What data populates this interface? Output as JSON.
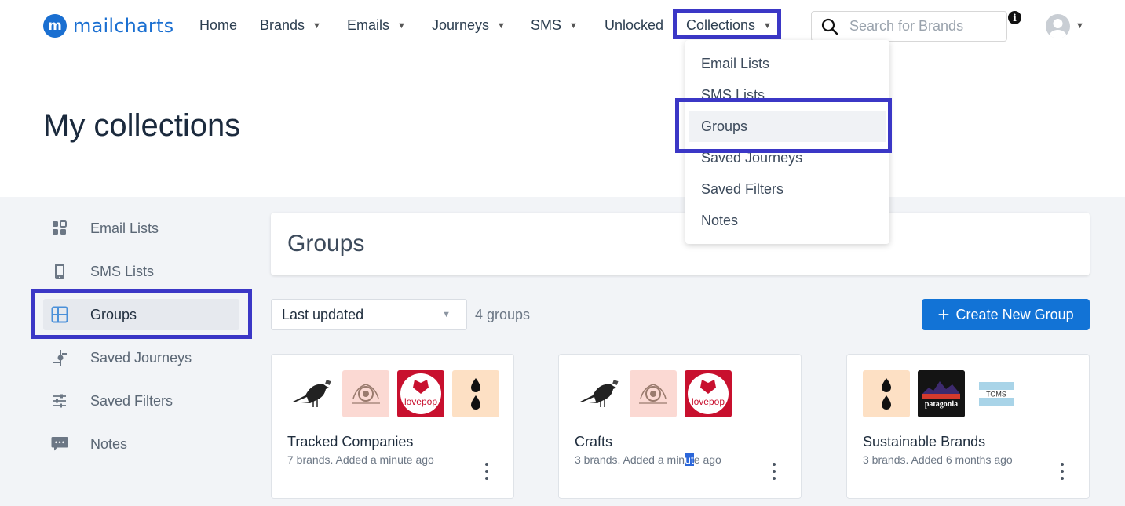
{
  "brand": {
    "name": "mailcharts",
    "mark": "m"
  },
  "nav": {
    "home": "Home",
    "brands": "Brands",
    "emails": "Emails",
    "journeys": "Journeys",
    "sms": "SMS",
    "unlocked": "Unlocked",
    "collections": "Collections"
  },
  "search": {
    "placeholder": "Search for Brands",
    "value": ""
  },
  "info_icon": "i",
  "dropdown": {
    "items": [
      "Email Lists",
      "SMS Lists",
      "Groups",
      "Saved Journeys",
      "Saved Filters",
      "Notes"
    ],
    "active": "Groups"
  },
  "page_title": "My collections",
  "sidebar": {
    "items": [
      {
        "label": "Email Lists",
        "icon": "grid-icon"
      },
      {
        "label": "SMS Lists",
        "icon": "phone-icon"
      },
      {
        "label": "Groups",
        "icon": "layout-icon"
      },
      {
        "label": "Saved Journeys",
        "icon": "journey-icon"
      },
      {
        "label": "Saved Filters",
        "icon": "sliders-icon"
      },
      {
        "label": "Notes",
        "icon": "chat-icon"
      }
    ],
    "active": "Groups"
  },
  "main": {
    "heading": "Groups",
    "sort": {
      "selected": "Last updated"
    },
    "count": "4 groups",
    "create_button": "Create New Group",
    "create_icon": "+"
  },
  "cards": [
    {
      "title": "Tracked Companies",
      "meta": "7 brands. Added a minute ago",
      "thumbs": [
        "pigeon-logo",
        "ornament-logo",
        "lovepop-logo",
        "drops-logo"
      ]
    },
    {
      "title": "Crafts",
      "meta_pre": "3 brands. Added a min",
      "meta_sel": "ut",
      "meta_post": "e ago",
      "thumbs": [
        "pigeon-logo",
        "ornament-logo",
        "lovepop-logo"
      ]
    },
    {
      "title": "Sustainable Brands",
      "meta": "3 brands. Added 6 months ago",
      "thumbs": [
        "drops-logo",
        "patagonia-logo",
        "toms-logo"
      ]
    }
  ],
  "logo_text": {
    "lovepop": "lovepop",
    "patagonia": "patagonia",
    "toms": "TOMS"
  },
  "colors": {
    "accent": "#1273d6",
    "highlight": "#3b37c6",
    "lovepop_red": "#c8102e",
    "peach": "#fde0c4",
    "pink": "#fbd9d3"
  }
}
